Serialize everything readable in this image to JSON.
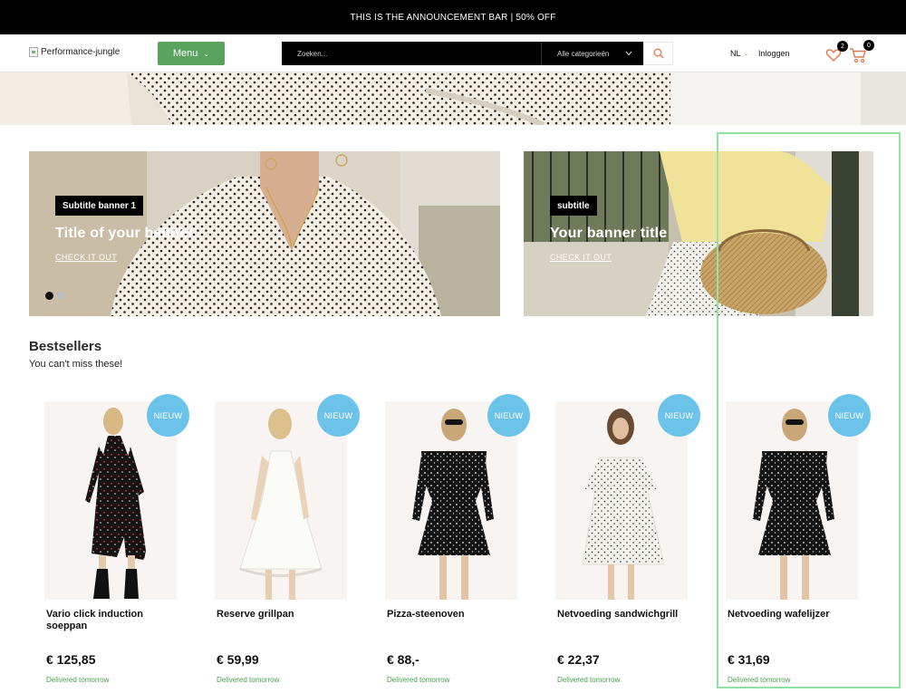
{
  "announcement": "THIS IS THE ANNOUNCEMENT BAR | 50% OFF",
  "header": {
    "logo_alt": "Performance-jungle",
    "menu_label": "Menu",
    "search_placeholder": "Zoeken...",
    "category_label": "Alle categorieën",
    "language": "NL",
    "login_label": "Inloggen",
    "wishlist_count": "2",
    "cart_count": "0"
  },
  "banners": [
    {
      "subtitle": "Subtitle banner 1",
      "title": "Title of your banner",
      "cta": "CHECK IT OUT"
    },
    {
      "subtitle": "subtitle",
      "title": "Your banner title",
      "cta": "CHECK IT OUT"
    }
  ],
  "bestsellers": {
    "title": "Bestsellers",
    "subtitle": "You can't miss these!",
    "products": [
      {
        "badge": "NIEUW",
        "name": "Vario click induction soeppan",
        "price": "€ 125,85",
        "delivery": "Delivered tomorrow",
        "dress": "black-floral"
      },
      {
        "badge": "NIEUW",
        "name": "Reserve grillpan",
        "price": "€ 59,99",
        "delivery": "Delivered tomorrow",
        "dress": "white-lace"
      },
      {
        "badge": "NIEUW",
        "name": "Pizza-steenoven",
        "price": "€ 88,-",
        "delivery": "Delivered tomorrow",
        "dress": "black-dots"
      },
      {
        "badge": "NIEUW",
        "name": "Netvoeding sandwichgrill",
        "price": "€ 22,37",
        "delivery": "Delivered tomorrow",
        "dress": "white-dots"
      },
      {
        "badge": "NIEUW",
        "name": "Netvoeding wafelijzer",
        "price": "€ 31,69",
        "delivery": "Delivered tomorrow",
        "dress": "black-dots"
      }
    ]
  },
  "colors": {
    "accent_green": "#5aa35e",
    "badge_blue": "#6cc3ea",
    "search_icon": "#e07a4a",
    "highlight_outline": "#8ee3a3"
  }
}
